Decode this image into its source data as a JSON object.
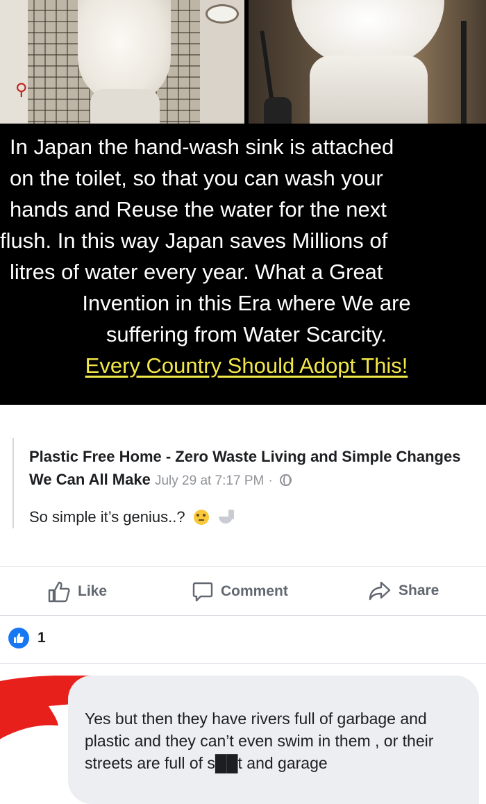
{
  "meme": {
    "watermark": "",
    "lines": [
      "In Japan the hand-wash sink is attached",
      "on the toilet, so that you can wash your",
      "hands and Reuse the water for the next",
      "flush. In this way Japan saves Millions of",
      "litres of water every year. What a Great",
      "Invention in this Era where We are",
      "suffering from Water Scarcity.",
      "Every Country Should Adopt This!"
    ],
    "highlight_color": "#f3e84a"
  },
  "post": {
    "author": "Plastic Free Home - Zero Waste Living and Simple Changes We Can All Make",
    "timestamp": "July 29 at 7:17 PM",
    "meta_separator": "·",
    "visibility_icon": "globe-icon",
    "text": "So simple it’s genius..?",
    "emojis": [
      "rolling-eyes-emoji",
      "toilet-emoji"
    ]
  },
  "actions": {
    "like": "Like",
    "comment": "Comment",
    "share": "Share"
  },
  "reactions": {
    "type": "like",
    "count": "1",
    "color": "#1877f2"
  },
  "comment": {
    "author_redacted": true,
    "redaction_color": "#e8201c",
    "text": "Yes but then they have rivers full of garbage and plastic and they can’t even swim in them , or their streets are full of s██t and garage"
  }
}
